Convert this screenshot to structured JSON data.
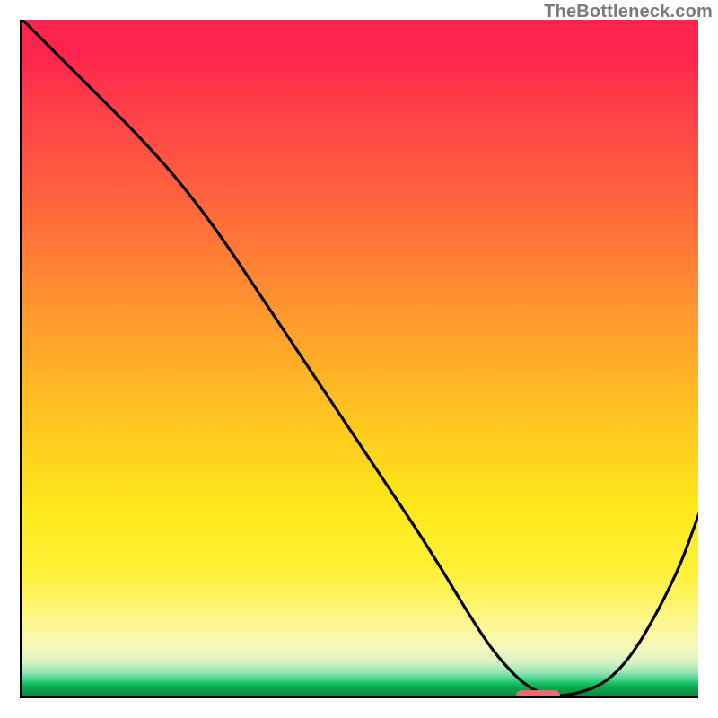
{
  "watermark": "TheBottleneck.com",
  "chart_data": {
    "type": "line",
    "title": "",
    "xlabel": "",
    "ylabel": "",
    "xlim": [
      0,
      100
    ],
    "ylim": [
      0,
      100
    ],
    "grid": false,
    "legend": false,
    "x": [
      0,
      8,
      20,
      28,
      36,
      44,
      52,
      60,
      66,
      70,
      75,
      80,
      88,
      96,
      100
    ],
    "y": [
      100,
      92,
      80,
      70,
      58,
      46,
      34,
      22,
      12,
      6,
      1,
      0,
      3,
      17,
      28
    ],
    "optimal_marker": {
      "x_start": 73,
      "x_end": 79,
      "y": 0
    },
    "colors": {
      "gradient_top": "#ff244d",
      "gradient_mid_orange": "#ff9d2d",
      "gradient_mid_yellow": "#ffe81a",
      "gradient_bottom_green": "#088a3d",
      "curve": "#000000",
      "marker": "#ea6a6f",
      "axes": "#000000",
      "watermark": "#7a7a7a"
    }
  }
}
